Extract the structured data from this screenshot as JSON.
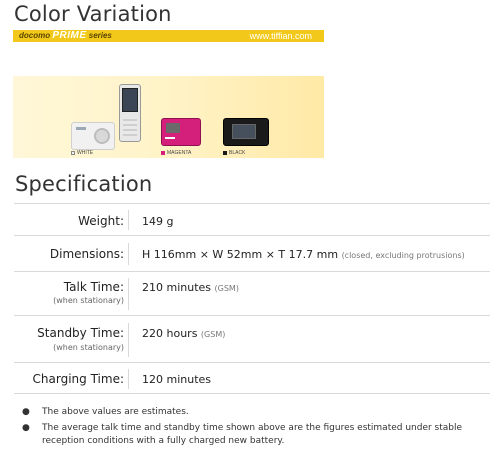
{
  "color_section": {
    "title": "Color Variation",
    "banner_brand_small": "docomo",
    "banner_brand_big": "PRIME",
    "banner_brand_series": "series",
    "banner_site": "www.tiffian.com",
    "variations": [
      {
        "label": "WHITE",
        "color": "#f4f4f4"
      },
      {
        "label": "MAGENTA",
        "color": "#d4207a"
      },
      {
        "label": "BLACK",
        "color": "#1a1a1a"
      }
    ]
  },
  "spec_section": {
    "title": "Specification",
    "rows": [
      {
        "label": "Weight:",
        "value": "149 g",
        "note": ""
      },
      {
        "label": "Dimensions:",
        "value": "H 116mm × W 52mm × T 17.7  mm",
        "note": "(closed, excluding protrusions)"
      },
      {
        "label": "Talk Time:",
        "sublabel": "(when stationary)",
        "value": "210 minutes",
        "note": "(GSM)"
      },
      {
        "label": "Standby Time:",
        "sublabel": "(when stationary)",
        "value": "220 hours",
        "note": "(GSM)"
      },
      {
        "label": "Charging Time:",
        "value": "120 minutes",
        "note": ""
      }
    ]
  },
  "notes": [
    "The above values are estimates.",
    "The average talk time and standby time shown above are the figures estimated under stable reception conditions with a fully charged new battery."
  ],
  "bullet": "●"
}
